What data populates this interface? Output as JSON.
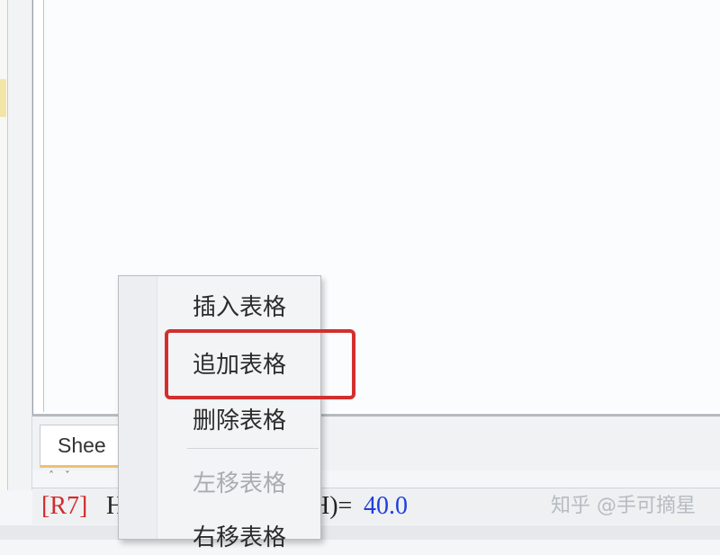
{
  "sheet_tab": {
    "label": "Shee"
  },
  "status_bar": {
    "prefix": "[R7]",
    "h_text": "H",
    "eq_text": "H)=",
    "value": "40.0"
  },
  "context_menu": {
    "items": [
      {
        "label": "插入表格",
        "enabled": true
      },
      {
        "label": "追加表格",
        "enabled": true,
        "highlighted": true
      },
      {
        "label": "删除表格",
        "enabled": true
      },
      {
        "label": "左移表格",
        "enabled": false
      },
      {
        "label": "右移表格",
        "enabled": true
      }
    ]
  },
  "annotation": {
    "highlight_color": "#d32f2f"
  },
  "watermark": {
    "text": "知乎 @手可摘星"
  },
  "colors": {
    "status_prefix": "#d12b2b",
    "status_value": "#1f3fdc"
  }
}
